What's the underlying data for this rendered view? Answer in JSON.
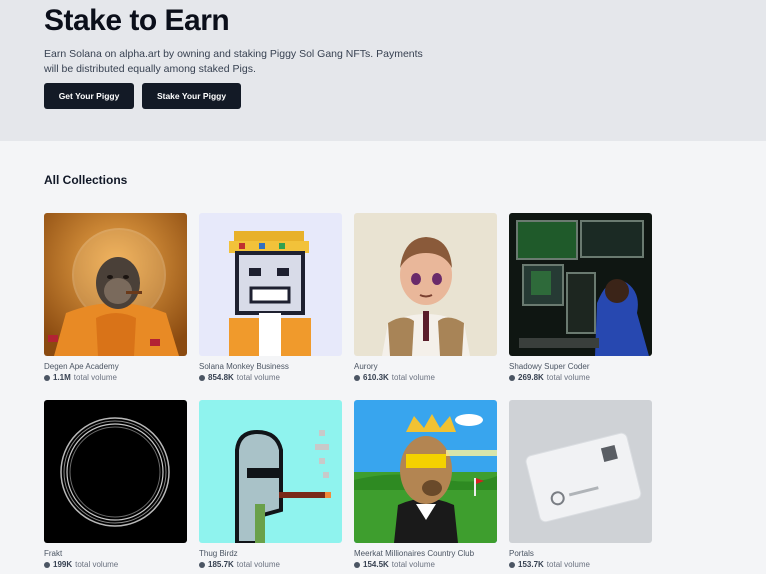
{
  "hero": {
    "title": "Stake to Earn",
    "description": "Earn Solana on alpha.art by owning and staking Piggy Sol Gang NFTs. Payments will be distributed equally among staked Pigs.",
    "buttons": [
      "Get Your Piggy",
      "Stake Your Piggy"
    ]
  },
  "collections": {
    "heading": "All Collections",
    "volume_suffix": "total volume",
    "items": [
      {
        "name": "Degen Ape Academy",
        "volume": "1.1M"
      },
      {
        "name": "Solana Monkey Business",
        "volume": "854.8K"
      },
      {
        "name": "Aurory",
        "volume": "610.3K"
      },
      {
        "name": "Shadowy Super Coder",
        "volume": "269.8K"
      },
      {
        "name": "Frakt",
        "volume": "199K"
      },
      {
        "name": "Thug Birdz",
        "volume": "185.7K"
      },
      {
        "name": "Meerkat Millionaires Country Club",
        "volume": "154.5K"
      },
      {
        "name": "Portals",
        "volume": "153.7K"
      }
    ]
  }
}
